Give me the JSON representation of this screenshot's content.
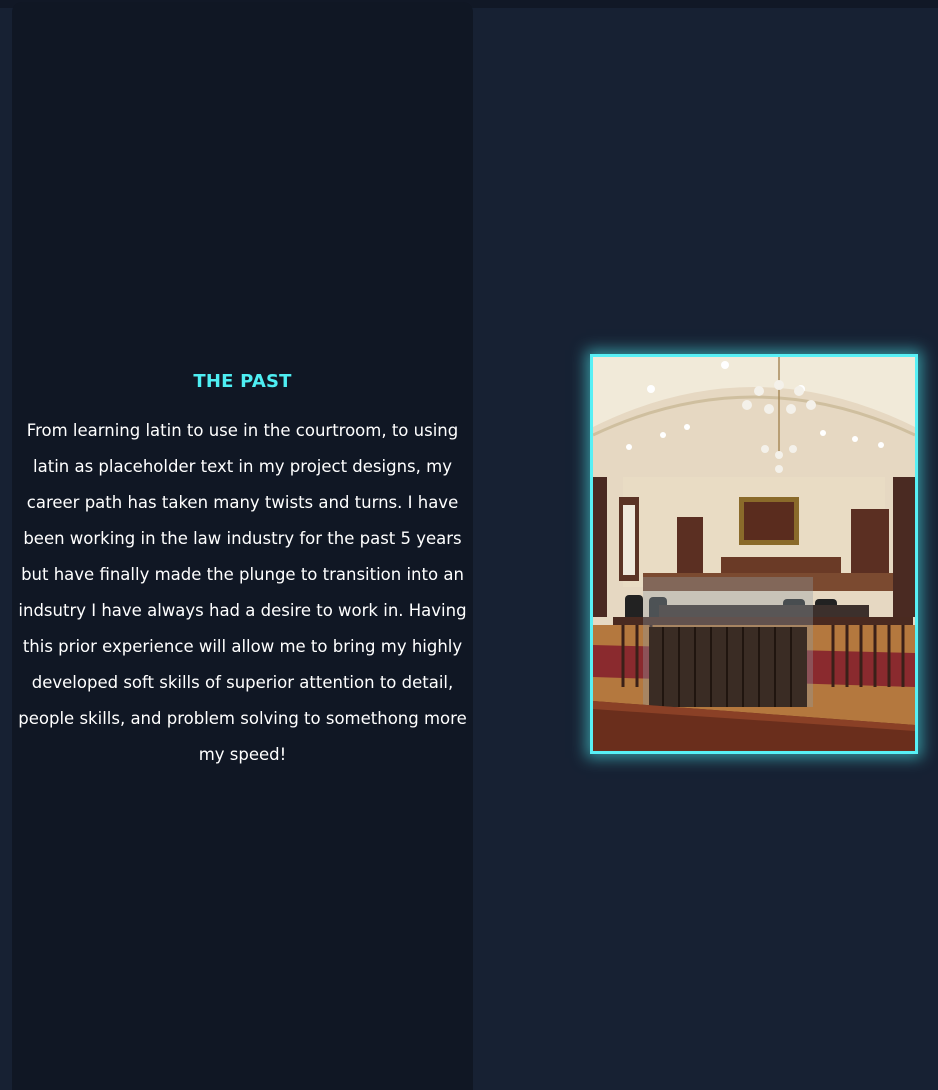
{
  "section": {
    "title": "THE PAST",
    "body": "From learning latin to use in the courtroom, to using latin as placeholder text in my project designs, my career path has taken many twists and turns. I have been working in the law industry for the past 5 years but have finally made the plunge to transition into an indsutry I have always had a desire to work in. Having this prior experience will allow me to bring my highly developed soft skills of superior attention to detail, people skills, and problem solving to somethong more my speed!"
  },
  "image": {
    "subject": "courtroom-interior-photo"
  },
  "colors": {
    "page_bg": "#172133",
    "panel_bg": "#101724",
    "accent": "#4eeef2",
    "text": "#ffffff"
  }
}
